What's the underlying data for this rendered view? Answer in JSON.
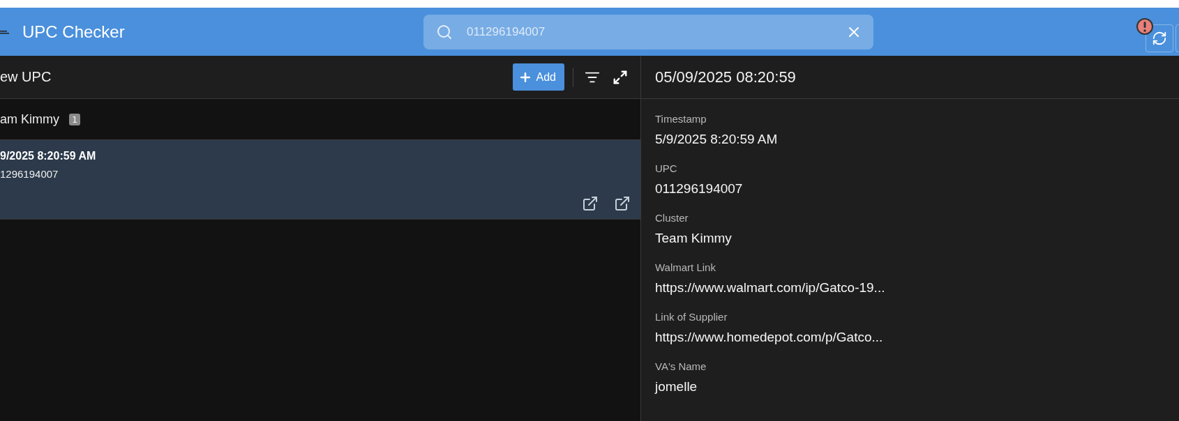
{
  "header": {
    "title": "UPC Checker",
    "search": {
      "value": "011296194007"
    }
  },
  "list_panel": {
    "title": "ew UPC",
    "add_button": "Add",
    "groups": [
      {
        "name": "am Kimmy",
        "count": "1",
        "items": [
          {
            "timestamp": "9/2025 8:20:59 AM",
            "upc": "1296194007",
            "selected": true
          }
        ]
      }
    ]
  },
  "detail": {
    "title": "05/09/2025 08:20:59",
    "fields": [
      {
        "label": "Timestamp",
        "value": "5/9/2025 8:20:59 AM"
      },
      {
        "label": "UPC",
        "value": "011296194007"
      },
      {
        "label": "Cluster",
        "value": "Team Kimmy"
      },
      {
        "label": "Walmart Link",
        "value": "https://www.walmart.com/ip/Gatco-19..."
      },
      {
        "label": "Link of Supplier",
        "value": "https://www.homedepot.com/p/Gatco..."
      },
      {
        "label": "VA's Name",
        "value": "jomelle"
      }
    ]
  }
}
